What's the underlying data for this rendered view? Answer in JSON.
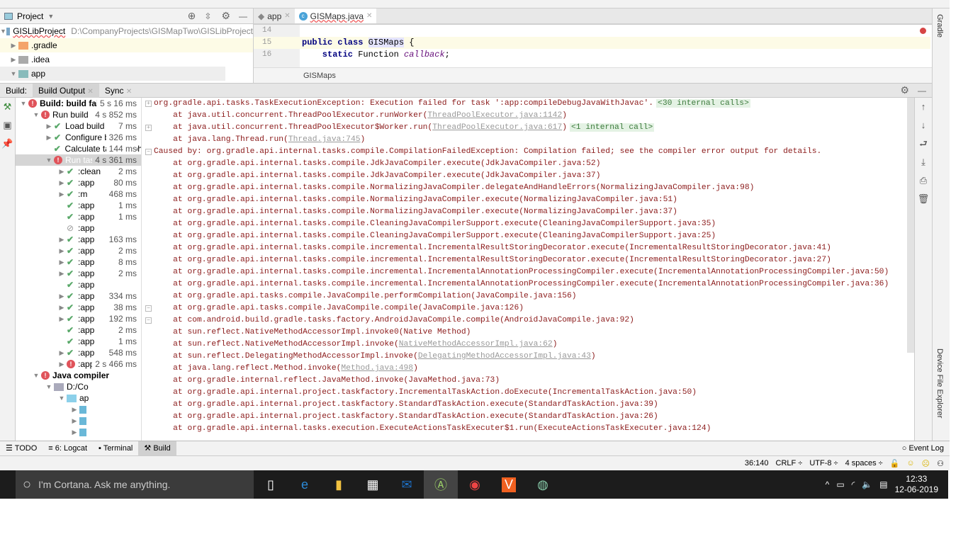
{
  "project_panel": {
    "title": "Project",
    "root": {
      "name": "GISLibProject",
      "path": "D:\\CompanyProjects\\GISMapTwo\\GISLibProject"
    },
    "items": [
      ".gradle",
      ".idea",
      "app"
    ]
  },
  "editor": {
    "tabs": [
      {
        "label": "app"
      },
      {
        "label": "GISMaps.java"
      }
    ],
    "line_numbers": [
      "14",
      "15",
      "16"
    ],
    "code": {
      "l15_kw": "public class ",
      "l15_name": "GISMaps",
      "l15_rest": " {",
      "l16_kw": "    static ",
      "l16_type": "Function ",
      "l16_var": "callback",
      "l16_end": ";"
    },
    "breadcrumb": "GISMaps"
  },
  "build_panel": {
    "label": "Build:",
    "tabs": [
      "Build Output",
      "Sync"
    ],
    "tree": [
      {
        "indent": 0,
        "tri": "down",
        "icon": "err",
        "label": "Build: build failed",
        "bold": true,
        "dur": "5 s 16 ms"
      },
      {
        "indent": 1,
        "tri": "down",
        "icon": "err",
        "label": "Run build",
        "dur": "4 s 852 ms"
      },
      {
        "indent": 2,
        "tri": "right",
        "icon": "ok",
        "label": "Load build",
        "dur": "7 ms"
      },
      {
        "indent": 2,
        "tri": "right",
        "icon": "ok",
        "label": "Configure build",
        "dur": "326 ms"
      },
      {
        "indent": 2,
        "tri": "",
        "icon": "ok",
        "label": "Calculate task graph",
        "dur": "144 ms"
      },
      {
        "indent": 2,
        "tri": "down",
        "icon": "err",
        "label": "Run tasks",
        "dur": "4 s 361 ms",
        "selected": true
      },
      {
        "indent": 3,
        "tri": "right",
        "icon": "ok",
        "label": ":clean",
        "dur": "2 ms"
      },
      {
        "indent": 3,
        "tri": "right",
        "icon": "ok",
        "label": ":app",
        "dur": "80 ms"
      },
      {
        "indent": 3,
        "tri": "right",
        "icon": "ok",
        "label": ":m",
        "dur": "468 ms"
      },
      {
        "indent": 3,
        "tri": "",
        "icon": "ok",
        "label": ":app",
        "dur": "1 ms"
      },
      {
        "indent": 3,
        "tri": "",
        "icon": "ok",
        "label": ":app",
        "dur": "1 ms"
      },
      {
        "indent": 3,
        "tri": "",
        "icon": "skip",
        "label": ":app",
        "dur": ""
      },
      {
        "indent": 3,
        "tri": "right",
        "icon": "ok",
        "label": ":app",
        "dur": "163 ms"
      },
      {
        "indent": 3,
        "tri": "right",
        "icon": "ok",
        "label": ":app",
        "dur": "2 ms"
      },
      {
        "indent": 3,
        "tri": "right",
        "icon": "ok",
        "label": ":app",
        "dur": "8 ms"
      },
      {
        "indent": 3,
        "tri": "right",
        "icon": "ok",
        "label": ":app",
        "dur": "2 ms"
      },
      {
        "indent": 3,
        "tri": "",
        "icon": "ok",
        "label": ":app",
        "dur": ""
      },
      {
        "indent": 3,
        "tri": "right",
        "icon": "ok",
        "label": ":app",
        "dur": "334 ms"
      },
      {
        "indent": 3,
        "tri": "right",
        "icon": "ok",
        "label": ":app",
        "dur": "38 ms"
      },
      {
        "indent": 3,
        "tri": "right",
        "icon": "ok",
        "label": ":app",
        "dur": "192 ms"
      },
      {
        "indent": 3,
        "tri": "",
        "icon": "ok",
        "label": ":app",
        "dur": "2 ms"
      },
      {
        "indent": 3,
        "tri": "",
        "icon": "ok",
        "label": ":app",
        "dur": "1 ms"
      },
      {
        "indent": 3,
        "tri": "right",
        "icon": "ok",
        "label": ":app",
        "dur": "548 ms"
      },
      {
        "indent": 3,
        "tri": "right",
        "icon": "err",
        "label": ":app",
        "dur": "2 s 466 ms"
      },
      {
        "indent": 1,
        "tri": "down",
        "icon": "err",
        "label": "Java compiler",
        "bold": true,
        "dur": ""
      },
      {
        "indent": 2,
        "tri": "down",
        "icon": "dir",
        "label": "D:/Co",
        "dur": ""
      },
      {
        "indent": 3,
        "tri": "down",
        "icon": "folder",
        "label": "ap",
        "dur": ""
      },
      {
        "indent": 4,
        "tri": "right",
        "icon": "file",
        "label": "",
        "dur": ""
      },
      {
        "indent": 4,
        "tri": "right",
        "icon": "file",
        "label": "",
        "dur": ""
      },
      {
        "indent": 4,
        "tri": "right",
        "icon": "file",
        "label": "",
        "dur": ""
      }
    ],
    "console": [
      {
        "fold": "+",
        "text": "org.gradle.api.tasks.TaskExecutionException: Execution failed for task ':app:compileDebugJavaWithJavac'.",
        "badge": "<30 internal calls>"
      },
      {
        "text": "    at java.util.concurrent.ThreadPoolExecutor.runWorker(",
        "link": "ThreadPoolExecutor.java:1142",
        "tail": ")"
      },
      {
        "fold": "+",
        "text": "    at java.util.concurrent.ThreadPoolExecutor$Worker.run(",
        "link": "ThreadPoolExecutor.java:617",
        "tail": ")",
        "badge": "<1 internal call>"
      },
      {
        "text": "    at java.lang.Thread.run(",
        "link": "Thread.java:745",
        "tail": ")"
      },
      {
        "fold": "-",
        "text": "Caused by: org.gradle.api.internal.tasks.compile.CompilationFailedException: Compilation failed; see the compiler error output for details."
      },
      {
        "text": "    at org.gradle.api.internal.tasks.compile.JdkJavaCompiler.execute(JdkJavaCompiler.java:52)"
      },
      {
        "text": "    at org.gradle.api.internal.tasks.compile.JdkJavaCompiler.execute(JdkJavaCompiler.java:37)"
      },
      {
        "text": "    at org.gradle.api.internal.tasks.compile.NormalizingJavaCompiler.delegateAndHandleErrors(NormalizingJavaCompiler.java:98)"
      },
      {
        "text": "    at org.gradle.api.internal.tasks.compile.NormalizingJavaCompiler.execute(NormalizingJavaCompiler.java:51)"
      },
      {
        "text": "    at org.gradle.api.internal.tasks.compile.NormalizingJavaCompiler.execute(NormalizingJavaCompiler.java:37)"
      },
      {
        "text": "    at org.gradle.api.internal.tasks.compile.CleaningJavaCompilerSupport.execute(CleaningJavaCompilerSupport.java:35)"
      },
      {
        "text": "    at org.gradle.api.internal.tasks.compile.CleaningJavaCompilerSupport.execute(CleaningJavaCompilerSupport.java:25)"
      },
      {
        "text": "    at org.gradle.api.internal.tasks.compile.incremental.IncrementalResultStoringDecorator.execute(IncrementalResultStoringDecorator.java:41)"
      },
      {
        "text": "    at org.gradle.api.internal.tasks.compile.incremental.IncrementalResultStoringDecorator.execute(IncrementalResultStoringDecorator.java:27)"
      },
      {
        "text": "    at org.gradle.api.internal.tasks.compile.incremental.IncrementalAnnotationProcessingCompiler.execute(IncrementalAnnotationProcessingCompiler.java:50)"
      },
      {
        "text": "    at org.gradle.api.internal.tasks.compile.incremental.IncrementalAnnotationProcessingCompiler.execute(IncrementalAnnotationProcessingCompiler.java:36)"
      },
      {
        "text": "    at org.gradle.api.tasks.compile.JavaCompile.performCompilation(JavaCompile.java:156)"
      },
      {
        "fold": "-",
        "text": "    at org.gradle.api.tasks.compile.JavaCompile.compile(JavaCompile.java:126)"
      },
      {
        "fold": "-",
        "text": "    at com.android.build.gradle.tasks.factory.AndroidJavaCompile.compile(AndroidJavaCompile.java:92)"
      },
      {
        "text": "    at sun.reflect.NativeMethodAccessorImpl.invoke0(Native Method)"
      },
      {
        "text": "    at sun.reflect.NativeMethodAccessorImpl.invoke(",
        "link": "NativeMethodAccessorImpl.java:62",
        "tail": ")"
      },
      {
        "text": "    at sun.reflect.DelegatingMethodAccessorImpl.invoke(",
        "link": "DelegatingMethodAccessorImpl.java:43",
        "tail": ")"
      },
      {
        "text": "    at java.lang.reflect.Method.invoke(",
        "link": "Method.java:498",
        "tail": ")"
      },
      {
        "text": "    at org.gradle.internal.reflect.JavaMethod.invoke(JavaMethod.java:73)"
      },
      {
        "text": "    at org.gradle.api.internal.project.taskfactory.IncrementalTaskAction.doExecute(IncrementalTaskAction.java:50)"
      },
      {
        "text": "    at org.gradle.api.internal.project.taskfactory.StandardTaskAction.execute(StandardTaskAction.java:39)"
      },
      {
        "text": "    at org.gradle.api.internal.project.taskfactory.StandardTaskAction.execute(StandardTaskAction.java:26)"
      },
      {
        "text": "    at org.gradle.api.internal.tasks.execution.ExecuteActionsTaskExecuter$1.run(ExecuteActionsTaskExecuter.java:124)"
      }
    ]
  },
  "right_strip": {
    "gradle": "Gradle",
    "device_explorer": "Device File Explorer"
  },
  "tool_windows": {
    "todo": "TODO",
    "logcat": "6: Logcat",
    "terminal": "Terminal",
    "build": "Build",
    "event_log": "Event Log"
  },
  "status_bar": {
    "position": "36:140",
    "line_sep": "CRLF ÷",
    "encoding": "UTF-8 ÷",
    "indent": "4 spaces ÷"
  },
  "taskbar": {
    "cortana_placeholder": "I'm Cortana. Ask me anything.",
    "time": "12:33",
    "date": "12-06-2019"
  }
}
